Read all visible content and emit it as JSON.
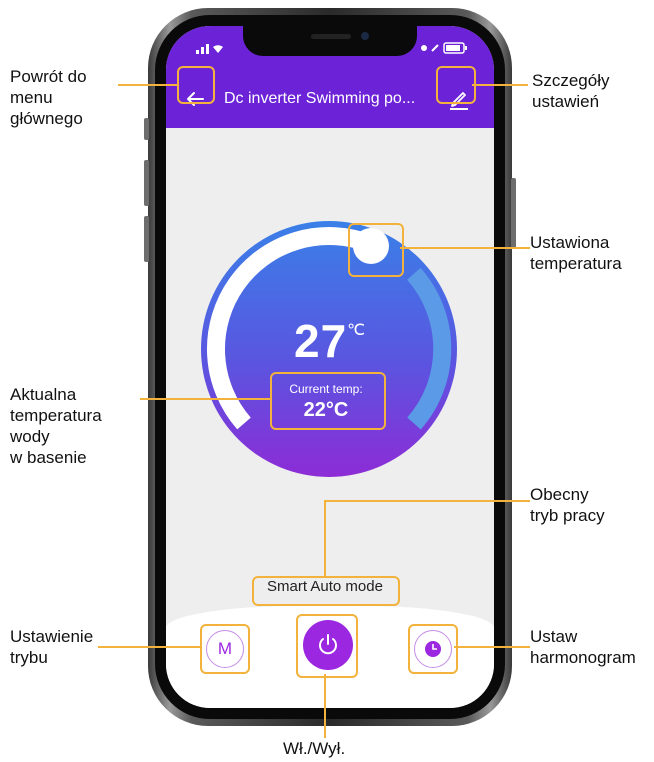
{
  "app": {
    "title": "Dc inverter Swimming po...",
    "set_temp_value": "27",
    "set_temp_unit": "℃",
    "current_temp_label": "Current temp:",
    "current_temp_value": "22°C",
    "mode_label": "Smart Auto mode",
    "mode_button_label": "M",
    "set_temp_fraction": 0.6
  },
  "annotations": {
    "back_line1": "Powrót do",
    "back_line2": "menu",
    "back_line3": "głównego",
    "settings_line1": "Szczegóły",
    "settings_line2": "ustawień",
    "set_temp_line1": "Ustawiona",
    "set_temp_line2": "temperatura",
    "current_temp_line1": "Aktualna",
    "current_temp_line2": "temperatura",
    "current_temp_line3": "wody",
    "current_temp_line4": "w basenie",
    "mode_now_line1": "Obecny",
    "mode_now_line2": "tryb pracy",
    "mode_set_line1": "Ustawienie",
    "mode_set_line2": "trybu",
    "schedule_line1": "Ustaw",
    "schedule_line2": "harmonogram",
    "power": "Wł./Wył."
  },
  "colors": {
    "header": "#6c22d6",
    "dial_top": "#3a7ee6",
    "dial_bottom": "#8a2ed4",
    "callout": "#f2b23b",
    "accent_purple": "#9b27e0"
  },
  "icons": {
    "back": "arrow-left-icon",
    "settings": "pencil-edit-icon",
    "power": "power-icon",
    "schedule": "clock-icon"
  }
}
